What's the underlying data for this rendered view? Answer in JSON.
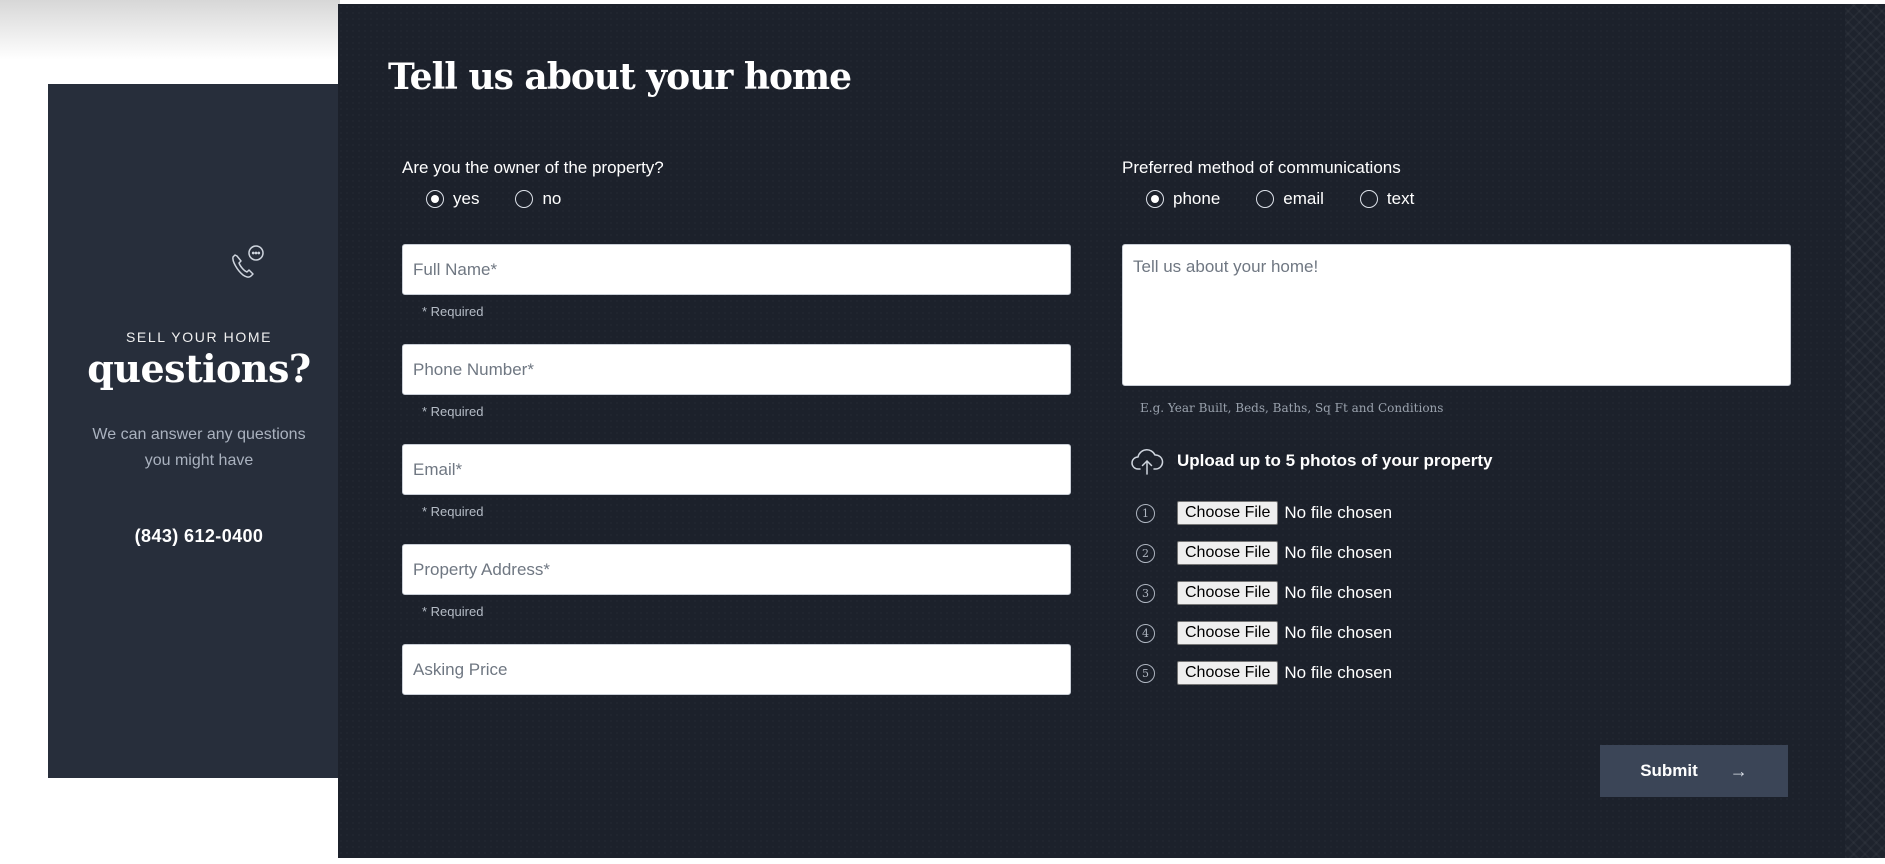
{
  "info_card": {
    "icon": "phone-chat-icon",
    "kicker": "SELL YOUR HOME",
    "heading": "questions?",
    "description": "We can answer any questions you might have",
    "phone": "(843) 612-0400"
  },
  "form": {
    "title": "Tell us about your home",
    "owner_question": {
      "label": "Are you the owner of the property?",
      "options": [
        "yes",
        "no"
      ],
      "selected": "yes"
    },
    "contact_question": {
      "label": "Preferred method of communications",
      "options": [
        "phone",
        "email",
        "text"
      ],
      "selected": "phone"
    },
    "fields": {
      "full_name": {
        "placeholder": "Full Name*",
        "value": "",
        "note": "* Required"
      },
      "phone_number": {
        "placeholder": "Phone Number*",
        "value": "",
        "note": "* Required"
      },
      "email": {
        "placeholder": "Email*",
        "value": "",
        "note": "* Required"
      },
      "property_address": {
        "placeholder": "Property Address*",
        "value": "",
        "note": "* Required"
      },
      "asking_price": {
        "placeholder": "Asking Price",
        "value": ""
      }
    },
    "home_details": {
      "placeholder": "Tell us about your home!",
      "hint": "E.g. Year Built, Beds, Baths, Sq Ft and Conditions"
    },
    "upload": {
      "icon": "cloud-upload-icon",
      "title": "Upload up to 5 photos of your property",
      "files": [
        {
          "number": "1",
          "button": "Choose File",
          "status": "No file chosen"
        },
        {
          "number": "2",
          "button": "Choose File",
          "status": "No file chosen"
        },
        {
          "number": "3",
          "button": "Choose File",
          "status": "No file chosen"
        },
        {
          "number": "4",
          "button": "Choose File",
          "status": "No file chosen"
        },
        {
          "number": "5",
          "button": "Choose File",
          "status": "No file chosen"
        }
      ]
    },
    "submit": {
      "label": "Submit",
      "icon": "arrow-right-icon"
    }
  }
}
